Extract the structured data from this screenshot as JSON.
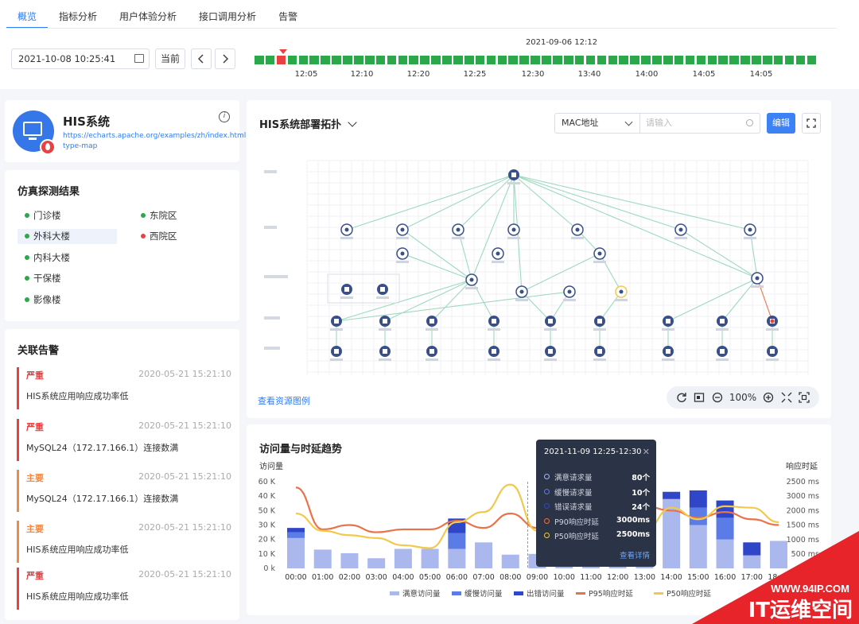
{
  "tabs": [
    {
      "label": "概览",
      "active": true
    },
    {
      "label": "指标分析"
    },
    {
      "label": "用户体验分析"
    },
    {
      "label": "接口调用分析"
    },
    {
      "label": "告警"
    }
  ],
  "toolbar": {
    "datetime": "2021-10-08 10:25:41",
    "current_label": "当前",
    "prev_icon": "chevron-left-icon",
    "next_icon": "chevron-right-icon"
  },
  "timeline": {
    "selected_date": "2021-09-06 12:12",
    "block_count": 51,
    "selected_index": 2,
    "ticks": [
      "12:05",
      "12:10",
      "12:20",
      "12:25",
      "12:30",
      "13:40",
      "14:00",
      "14:05",
      "14:05"
    ],
    "colors": {
      "ok": "#2ba84a",
      "alert": "#e84142"
    }
  },
  "system": {
    "title": "HIS系统",
    "url": "https://echarts.apache.org/examples/zh/index.html#chart-type-map",
    "icon": "monitor-fire-icon"
  },
  "regions": {
    "title": "仿真探测结果",
    "items": [
      {
        "label": "门诊楼",
        "status": "#2ba84a"
      },
      {
        "label": "东院区",
        "status": "#2ba84a"
      },
      {
        "label": "外科大楼",
        "status": "#2ba84a",
        "selected": true
      },
      {
        "label": "西院区",
        "status": "#e84142"
      },
      {
        "label": "内科大楼",
        "status": "#2ba84a"
      },
      {
        "label": "干保楼",
        "status": "#2ba84a"
      },
      {
        "label": "影像楼",
        "status": "#2ba84a"
      }
    ]
  },
  "alerts": {
    "title": "关联告警",
    "items": [
      {
        "level": "严重",
        "time": "2020-05-21 15:21:10",
        "message": "HIS系统应用响应成功率低",
        "kind": "critical"
      },
      {
        "level": "严重",
        "time": "2020-05-21 15:21:10",
        "message": "MySQL24（172.17.166.1）连接数满",
        "kind": "critical"
      },
      {
        "level": "主要",
        "time": "2020-05-21 15:21:10",
        "message": "MySQL24（172.17.166.1）连接数满",
        "kind": "major"
      },
      {
        "level": "主要",
        "time": "2020-05-21 15:21:10",
        "message": "HIS系统应用响应成功率低",
        "kind": "major"
      },
      {
        "level": "严重",
        "time": "2020-05-21 15:21:10",
        "message": "HIS系统应用响应成功率低",
        "kind": "critical"
      }
    ]
  },
  "topology": {
    "title": "HIS系统部署拓扑",
    "filter_value": "MAC地址",
    "search_placeholder": "请输入",
    "edit_label": "编辑",
    "legend_link": "查看资源图例",
    "zoom_level": "100%",
    "accent": "#3c82f5"
  },
  "trend": {
    "title": "访问量与时延趋势",
    "left_axis_title": "访问量",
    "right_axis_title": "响应时延",
    "tooltip": {
      "title": "2021-11-09 12:25-12:30",
      "rows": [
        {
          "name": "满意请求量",
          "value": "80个",
          "color": "#aab8ee"
        },
        {
          "name": "缓慢请求量",
          "value": "10个",
          "color": "#5b7be6"
        },
        {
          "name": "错误请求量",
          "value": "24个",
          "color": "#2f46c8"
        },
        {
          "name": "P90响应时延",
          "value": "3000ms",
          "color": "#e8734a"
        },
        {
          "name": "P50响应时延",
          "value": "2500ms",
          "color": "#f2c94c"
        }
      ],
      "link": "查看详情"
    }
  },
  "chart_data": {
    "type": "bar",
    "categories": [
      "00:00",
      "01:00",
      "02:00",
      "03:00",
      "04:00",
      "05:00",
      "06:00",
      "07:00",
      "08:00",
      "09:00",
      "10:00",
      "11:00",
      "12:00",
      "13:00",
      "14:00",
      "15:00",
      "16:00",
      "17:00",
      "18:00"
    ],
    "left_ticks": [
      "60 K",
      "40 K",
      "50 K",
      "30 K",
      "20 K",
      "10 K",
      "0 k"
    ],
    "right_ticks": [
      "2500 ms",
      "3000 ms",
      "2000 ms",
      "1500 ms",
      "1000 ms",
      "500 ms"
    ],
    "ylim": [
      0,
      60000
    ],
    "y2lim": [
      0,
      3000
    ],
    "series": [
      {
        "name": "满意访问量",
        "kind": "bar",
        "color": "#aab8ee",
        "values": [
          21000,
          13000,
          10500,
          7000,
          13500,
          13500,
          13500,
          18000,
          9500,
          10000,
          10000,
          9500,
          10500,
          26000,
          48000,
          30000,
          20000,
          9000,
          19000
        ]
      },
      {
        "name": "缓慢访问量",
        "kind": "bar",
        "color": "#5b7be6",
        "values": [
          4000,
          0,
          0,
          0,
          0,
          0,
          11000,
          0,
          0,
          0,
          0,
          0,
          0,
          14000,
          0,
          12000,
          15000,
          0,
          0
        ]
      },
      {
        "name": "出错访问量",
        "kind": "bar",
        "color": "#2f46c8",
        "values": [
          3000,
          0,
          0,
          0,
          0,
          0,
          10000,
          0,
          0,
          0,
          0,
          0,
          0,
          0,
          5000,
          12000,
          12000,
          9000,
          0
        ]
      },
      {
        "name": "P95响应时延",
        "kind": "line",
        "color": "#e8734a",
        "values": [
          2800,
          1350,
          1500,
          1250,
          1350,
          1350,
          1650,
          1400,
          1900,
          1400,
          1300,
          1400,
          2400,
          2150,
          2000,
          1750,
          1950,
          1700,
          1500
        ]
      },
      {
        "name": "P50响应时延",
        "kind": "line",
        "color": "#f2c94c",
        "values": [
          1900,
          1300,
          1150,
          1050,
          800,
          700,
          1600,
          1950,
          2900,
          1300,
          1000,
          1050,
          1900,
          1300,
          2100,
          1700,
          2150,
          2100,
          1600
        ]
      }
    ]
  },
  "watermark": {
    "line1": "WWW.94IP.COM",
    "line2": "IT运维空间"
  }
}
